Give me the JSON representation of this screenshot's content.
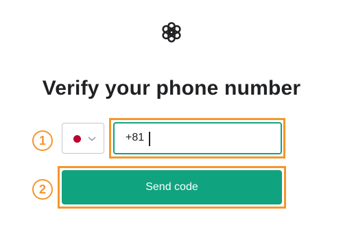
{
  "header": {
    "logo_icon": "openai-logo-icon",
    "title": "Verify your phone number"
  },
  "steps": {
    "step1_label": "1",
    "step2_label": "2",
    "highlight_color": "#f5962a"
  },
  "country_select": {
    "flag": "japan-flag-icon",
    "flag_color": "#bc002d",
    "dropdown_icon": "chevron-down-icon"
  },
  "phone_input": {
    "value": "+81",
    "border_color": "#10a37f"
  },
  "send_button": {
    "label": "Send code",
    "color": "#10a37f"
  }
}
